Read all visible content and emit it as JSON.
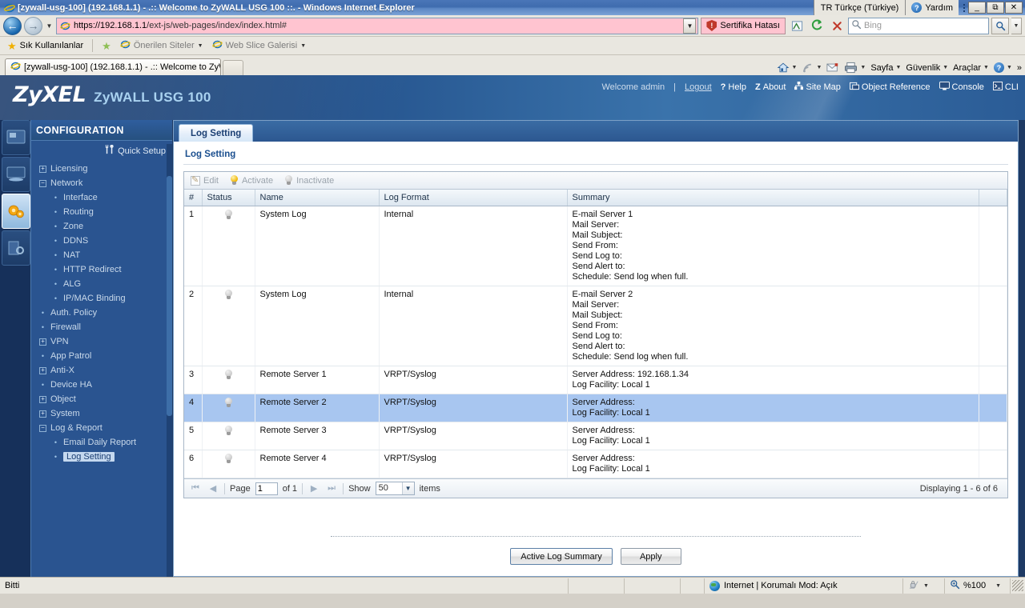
{
  "browser": {
    "window_title": "[zywall-usg-100] (192.168.1.1) - .:: Welcome to ZyWALL USG 100 ::. - Windows Internet Explorer",
    "language_indicator": "TR Türkçe (Türkiye)",
    "help_label": "Yardım",
    "url_scheme": "https://192.168.1.1",
    "url_path": "/ext-js/web-pages/index/index.html#",
    "cert_error": "Sertifika Hatası",
    "search_placeholder": "Bing",
    "favorites_label": "Sık Kullanılanlar",
    "suggested_sites": "Önerilen Siteler",
    "web_slice": "Web Slice Galerisi",
    "tab_title": "[zywall-usg-100] (192.168.1.1) - .:: Welcome to ZyW...",
    "commands": [
      "Sayfa",
      "Güvenlik",
      "Araçlar"
    ],
    "status_text": "Bitti",
    "zone_text": "Internet | Korumalı Mod: Açık",
    "zoom_level": "%100"
  },
  "device": {
    "brand": "ZyXEL",
    "model": "ZyWALL USG 100",
    "welcome": "Welcome admin",
    "logout": "Logout",
    "topnav": [
      {
        "label": "Help",
        "icon": "question-icon"
      },
      {
        "label": "About",
        "icon": "z-icon"
      },
      {
        "label": "Site Map",
        "icon": "sitemap-icon"
      },
      {
        "label": "Object Reference",
        "icon": "object-reference-icon"
      },
      {
        "label": "Console",
        "icon": "console-icon"
      },
      {
        "label": "CLI",
        "icon": "cli-icon"
      }
    ]
  },
  "sidebar": {
    "title": "CONFIGURATION",
    "quick_setup": "Quick Setup",
    "items": [
      {
        "label": "Licensing",
        "type": "plus",
        "level": 1,
        "active": false
      },
      {
        "label": "Network",
        "type": "minus",
        "level": 1,
        "active": false
      },
      {
        "label": "Interface",
        "type": "dot",
        "level": 2,
        "active": false
      },
      {
        "label": "Routing",
        "type": "dot",
        "level": 2,
        "active": false
      },
      {
        "label": "Zone",
        "type": "dot",
        "level": 2,
        "active": false
      },
      {
        "label": "DDNS",
        "type": "dot",
        "level": 2,
        "active": false
      },
      {
        "label": "NAT",
        "type": "dot",
        "level": 2,
        "active": false
      },
      {
        "label": "HTTP Redirect",
        "type": "dot",
        "level": 2,
        "active": false
      },
      {
        "label": "ALG",
        "type": "dot",
        "level": 2,
        "active": false
      },
      {
        "label": "IP/MAC Binding",
        "type": "dot",
        "level": 2,
        "active": false
      },
      {
        "label": "Auth. Policy",
        "type": "dot",
        "level": 1,
        "active": false
      },
      {
        "label": "Firewall",
        "type": "dot",
        "level": 1,
        "active": false
      },
      {
        "label": "VPN",
        "type": "plus",
        "level": 1,
        "active": false
      },
      {
        "label": "App Patrol",
        "type": "dot",
        "level": 1,
        "active": false
      },
      {
        "label": "Anti-X",
        "type": "plus",
        "level": 1,
        "active": false
      },
      {
        "label": "Device HA",
        "type": "dot",
        "level": 1,
        "active": false
      },
      {
        "label": "Object",
        "type": "plus",
        "level": 1,
        "active": false
      },
      {
        "label": "System",
        "type": "plus",
        "level": 1,
        "active": false
      },
      {
        "label": "Log & Report",
        "type": "minus",
        "level": 1,
        "active": false
      },
      {
        "label": "Email Daily Report",
        "type": "dot",
        "level": 2,
        "active": false
      },
      {
        "label": "Log Setting",
        "type": "dot",
        "level": 2,
        "active": true
      }
    ]
  },
  "main": {
    "tab_label": "Log Setting",
    "panel_title": "Log Setting",
    "toolbar": [
      {
        "label": "Edit",
        "icon": "edit-icon"
      },
      {
        "label": "Activate",
        "icon": "bulb-on-icon"
      },
      {
        "label": "Inactivate",
        "icon": "bulb-off-icon"
      }
    ],
    "columns": [
      "#",
      "Status",
      "Name",
      "Log Format",
      "Summary"
    ],
    "rows": [
      {
        "num": "1",
        "status": "off",
        "name": "System Log",
        "format": "Internal",
        "summary": [
          "E-mail Server 1",
          "Mail Server:",
          "Mail Subject:",
          "Send From:",
          "Send Log to:",
          "Send Alert to:",
          "Schedule: Send log when full."
        ],
        "selected": false
      },
      {
        "num": "2",
        "status": "off",
        "name": "System Log",
        "format": "Internal",
        "summary": [
          "E-mail Server 2",
          "Mail Server:",
          "Mail Subject:",
          "Send From:",
          "Send Log to:",
          "Send Alert to:",
          "Schedule: Send log when full."
        ],
        "selected": false
      },
      {
        "num": "3",
        "status": "off",
        "name": "Remote Server 1",
        "format": "VRPT/Syslog",
        "summary": [
          "Server Address: 192.168.1.34",
          "Log Facility: Local 1"
        ],
        "selected": false
      },
      {
        "num": "4",
        "status": "off",
        "name": "Remote Server 2",
        "format": "VRPT/Syslog",
        "summary": [
          "Server Address:",
          "Log Facility: Local 1"
        ],
        "selected": true
      },
      {
        "num": "5",
        "status": "off",
        "name": "Remote Server 3",
        "format": "VRPT/Syslog",
        "summary": [
          "Server Address:",
          "Log Facility: Local 1"
        ],
        "selected": false
      },
      {
        "num": "6",
        "status": "off",
        "name": "Remote Server 4",
        "format": "VRPT/Syslog",
        "summary": [
          "Server Address:",
          "Log Facility: Local 1"
        ],
        "selected": false
      }
    ],
    "pager": {
      "page_label": "Page",
      "page_value": "1",
      "of_label": "of 1",
      "show_label": "Show",
      "show_value": "50",
      "items_label": "items",
      "displaying": "Displaying 1 - 6 of 6"
    },
    "buttons": [
      {
        "label": "Active Log Summary"
      },
      {
        "label": "Apply"
      }
    ]
  }
}
